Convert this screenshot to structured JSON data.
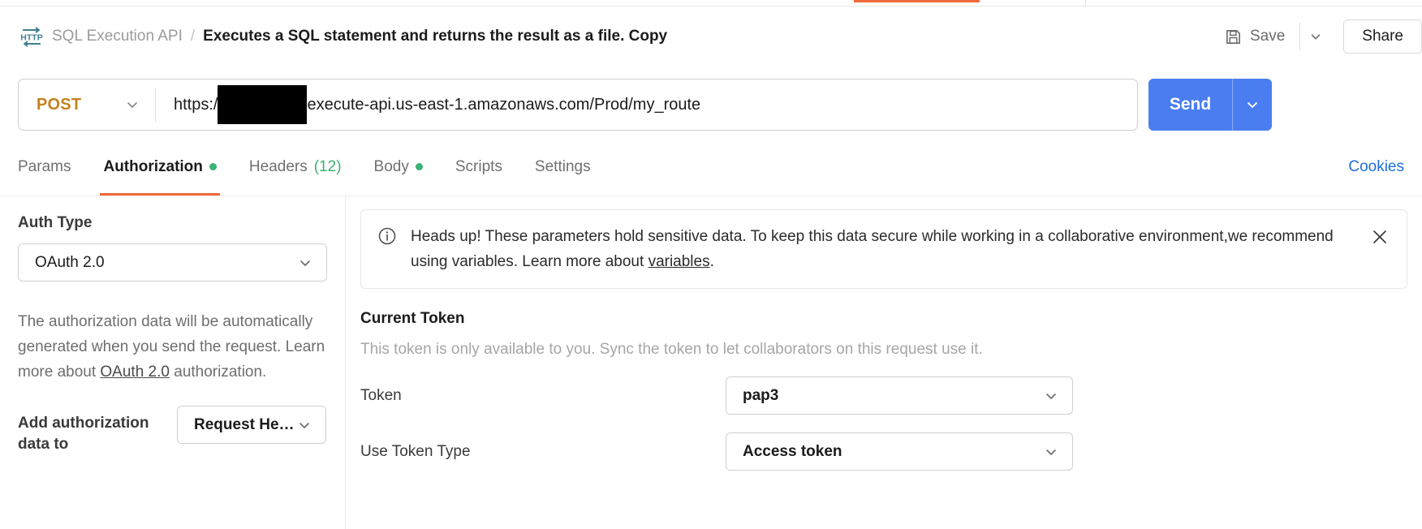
{
  "header": {
    "protocol_icon": "http-icon",
    "collection_name": "SQL Execution API",
    "separator": "/",
    "request_name": "Executes a SQL statement and returns the result as a file. Copy",
    "save_label": "Save",
    "save_icon": "floppy-disk-icon",
    "save_caret_icon": "chevron-down-icon",
    "share_label": "Share"
  },
  "url_bar": {
    "method": "POST",
    "method_caret_icon": "chevron-down-icon",
    "url_prefix": "https:/",
    "url_redacted": "",
    "url_suffix": "execute-api.us-east-1.amazonaws.com/Prod/my_route",
    "send_label": "Send",
    "send_caret_icon": "chevron-down-icon"
  },
  "request_tabs": {
    "items": [
      {
        "label": "Params",
        "badge": "",
        "dot": false,
        "active": false
      },
      {
        "label": "Authorization",
        "badge": "",
        "dot": true,
        "active": true
      },
      {
        "label": "Headers",
        "badge": "(12)",
        "dot": false,
        "active": false
      },
      {
        "label": "Body",
        "badge": "",
        "dot": true,
        "active": false
      },
      {
        "label": "Scripts",
        "badge": "",
        "dot": false,
        "active": false
      },
      {
        "label": "Settings",
        "badge": "",
        "dot": false,
        "active": false
      }
    ],
    "cookies_label": "Cookies"
  },
  "auth_panel": {
    "auth_type_label": "Auth Type",
    "auth_type_value": "OAuth 2.0",
    "auth_type_caret_icon": "chevron-down-icon",
    "description_part1": "The authorization data will be automatically generated when you send the request. Learn more about ",
    "description_link": "OAuth 2.0",
    "description_part2": " authorization.",
    "add_auth_label": "Add authorization data to",
    "add_auth_value": "Request He…",
    "add_auth_caret_icon": "chevron-down-icon"
  },
  "info_banner": {
    "icon": "info-circle-icon",
    "text_part1": "Heads up! These parameters hold sensitive data. To keep this data secure while working in a collaborative environment,we recommend using variables. Learn more about ",
    "link": "variables",
    "text_part2": ".",
    "close_icon": "close-icon"
  },
  "token_section": {
    "title": "Current Token",
    "subtitle": "This token is only available to you. Sync the token to let collaborators on this request use it.",
    "rows": [
      {
        "key": "Token",
        "value": "pap3",
        "caret_icon": "chevron-down-icon"
      },
      {
        "key": "Use Token Type",
        "value": "Access token",
        "caret_icon": "chevron-down-icon"
      }
    ]
  },
  "colors": {
    "accent_orange": "#f26b3a",
    "send_blue": "#4a7df0",
    "link_blue": "#1f6fe0",
    "method_orange": "#c5821d",
    "dot_green": "#3bb273"
  }
}
